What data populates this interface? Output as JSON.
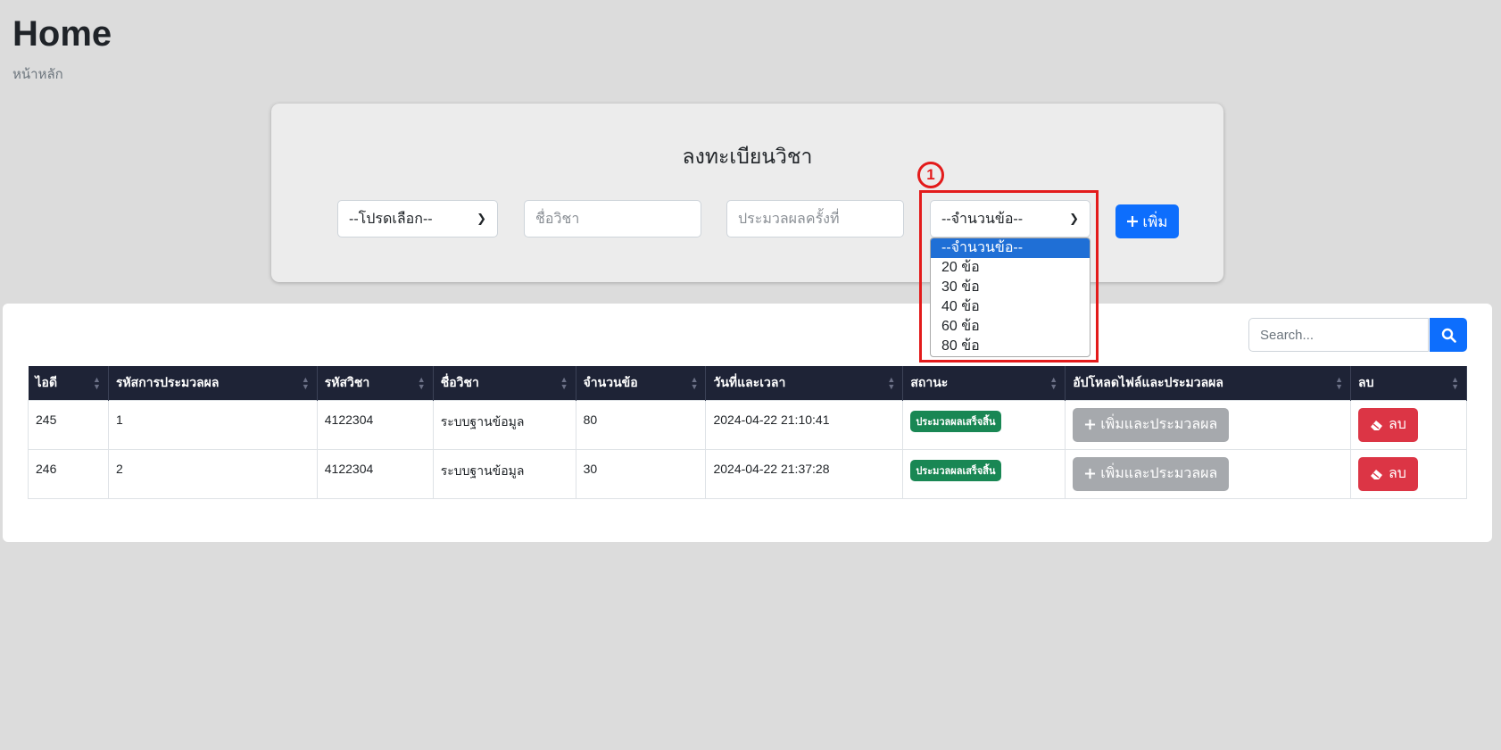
{
  "header": {
    "title": "Home",
    "subtitle": "หน้าหลัก"
  },
  "register_form": {
    "title": "ลงทะเบียนวิชา",
    "subject_select": {
      "value": "--โปรดเลือก--"
    },
    "subject_name": {
      "placeholder": "ชื่อวิชา"
    },
    "round": {
      "placeholder": "ประมวลผลครั้งที่"
    },
    "question_count": {
      "value": "--จำนวนข้อ--",
      "options": [
        "--จำนวนข้อ--",
        "20 ข้อ",
        "30 ข้อ",
        "40 ข้อ",
        "60 ข้อ",
        "80 ข้อ"
      ]
    },
    "add_button": "เพิ่ม"
  },
  "annotation": {
    "step_number": "1",
    "color": "#e31b1b"
  },
  "search": {
    "placeholder": "Search..."
  },
  "table": {
    "columns": [
      "ไอดี",
      "รหัสการประมวลผล",
      "รหัสวิชา",
      "ชื่อวิชา",
      "จำนวนข้อ",
      "วันที่และเวลา",
      "สถานะ",
      "อัปโหลดไฟล์และประมวลผล",
      "ลบ"
    ],
    "rows": [
      {
        "id": "245",
        "process_code": "1",
        "course_code": "4122304",
        "course_name": "ระบบฐานข้อมูล",
        "questions": "80",
        "datetime": "2024-04-22 21:10:41",
        "status": "ประมวลผลเสร็จสิ้น",
        "upload_label": "เพิ่มและประมวลผล",
        "delete_label": "ลบ"
      },
      {
        "id": "246",
        "process_code": "2",
        "course_code": "4122304",
        "course_name": "ระบบฐานข้อมูล",
        "questions": "30",
        "datetime": "2024-04-22 21:37:28",
        "status": "ประมวลผลเสร็จสิ้น",
        "upload_label": "เพิ่มและประมวลผล",
        "delete_label": "ลบ"
      }
    ]
  },
  "colors": {
    "primary": "#0d6efd",
    "danger": "#dc3545",
    "success": "#198754",
    "header_dark": "#1e2336",
    "muted_button": "#a6a9ad"
  },
  "icons": {
    "add": "plus-icon",
    "search": "search-icon",
    "delete": "eraser-icon",
    "select": "chevron-down-icon"
  }
}
